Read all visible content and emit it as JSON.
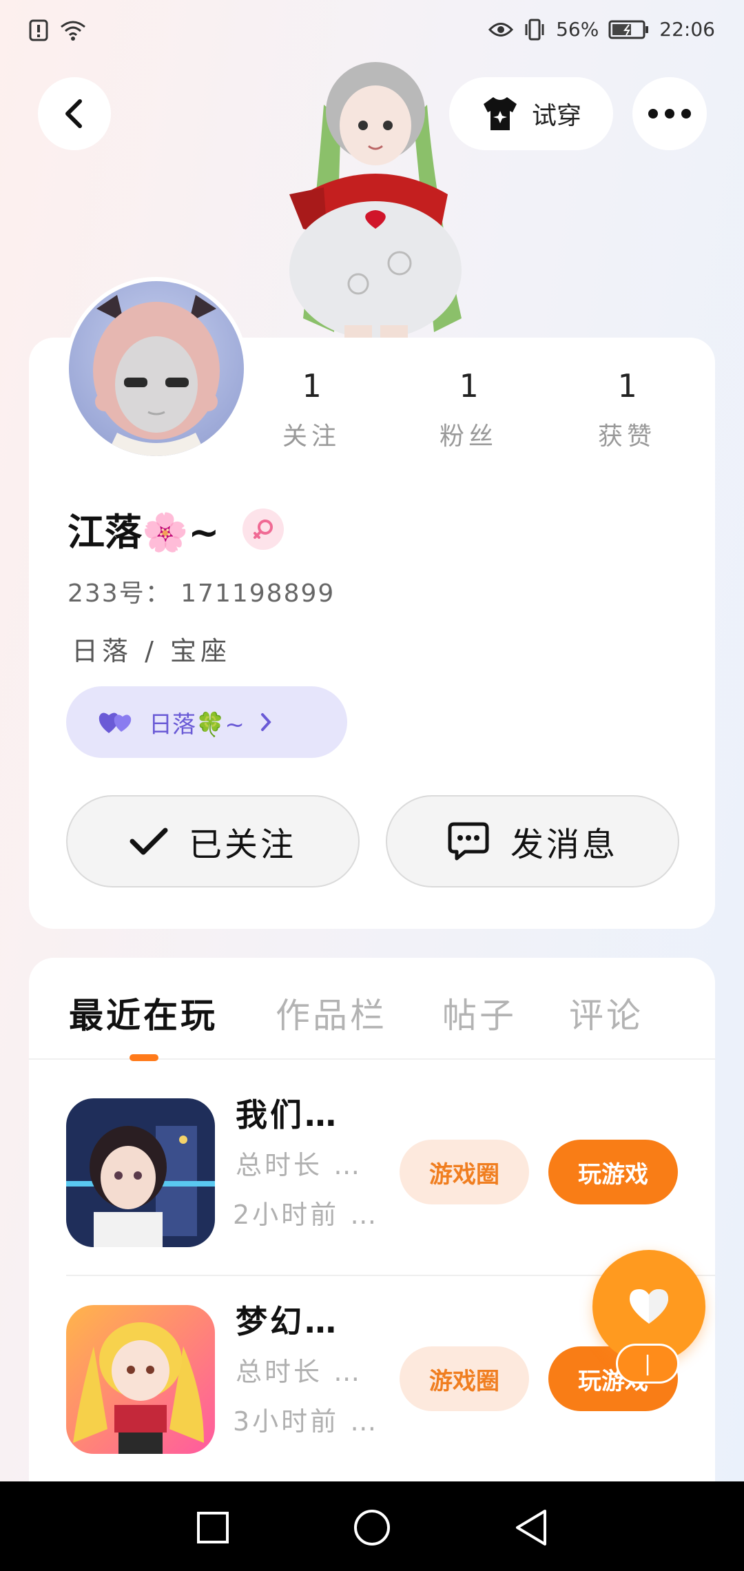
{
  "status_bar": {
    "battery": "56%",
    "time": "22:06",
    "icons": [
      "alert-icon",
      "wifi-icon",
      "eye-comfort-icon",
      "vibrate-icon",
      "battery-icon"
    ]
  },
  "header": {
    "back_icon": "back-arrow-icon",
    "tryon_label": "试穿",
    "more_icon": "more-dots-icon"
  },
  "profile": {
    "stats": [
      {
        "value": "1",
        "label": "关注"
      },
      {
        "value": "1",
        "label": "粉丝"
      },
      {
        "value": "1",
        "label": "获赞"
      }
    ],
    "name": "江落🌸~",
    "gender_icon": "female-icon",
    "uid": "233号： 171198899",
    "bio": "日落 / 宝座",
    "cp_label": "日落🍀~",
    "follow_label": "已关注",
    "message_label": "发消息"
  },
  "tabs": [
    {
      "label": "最近在玩",
      "active": true
    },
    {
      "label": "作品栏",
      "active": false
    },
    {
      "label": "帖子",
      "active": false
    },
    {
      "label": "评论",
      "active": false
    }
  ],
  "games": [
    {
      "title": "我们…",
      "duration": "总时长 …",
      "last_played": "2小时前 …",
      "circle_label": "游戏圈",
      "play_label": "玩游戏"
    },
    {
      "title": "梦幻…",
      "duration": "总时长 …",
      "last_played": "3小时前 …",
      "circle_label": "游戏圈",
      "play_label": "玩游戏"
    }
  ],
  "fab": {
    "icon": "heart-icon",
    "badge": "|"
  },
  "colors": {
    "accent": "#f97d16",
    "cp_purple": "#6a5ad6",
    "female_pink": "#f06a94"
  }
}
